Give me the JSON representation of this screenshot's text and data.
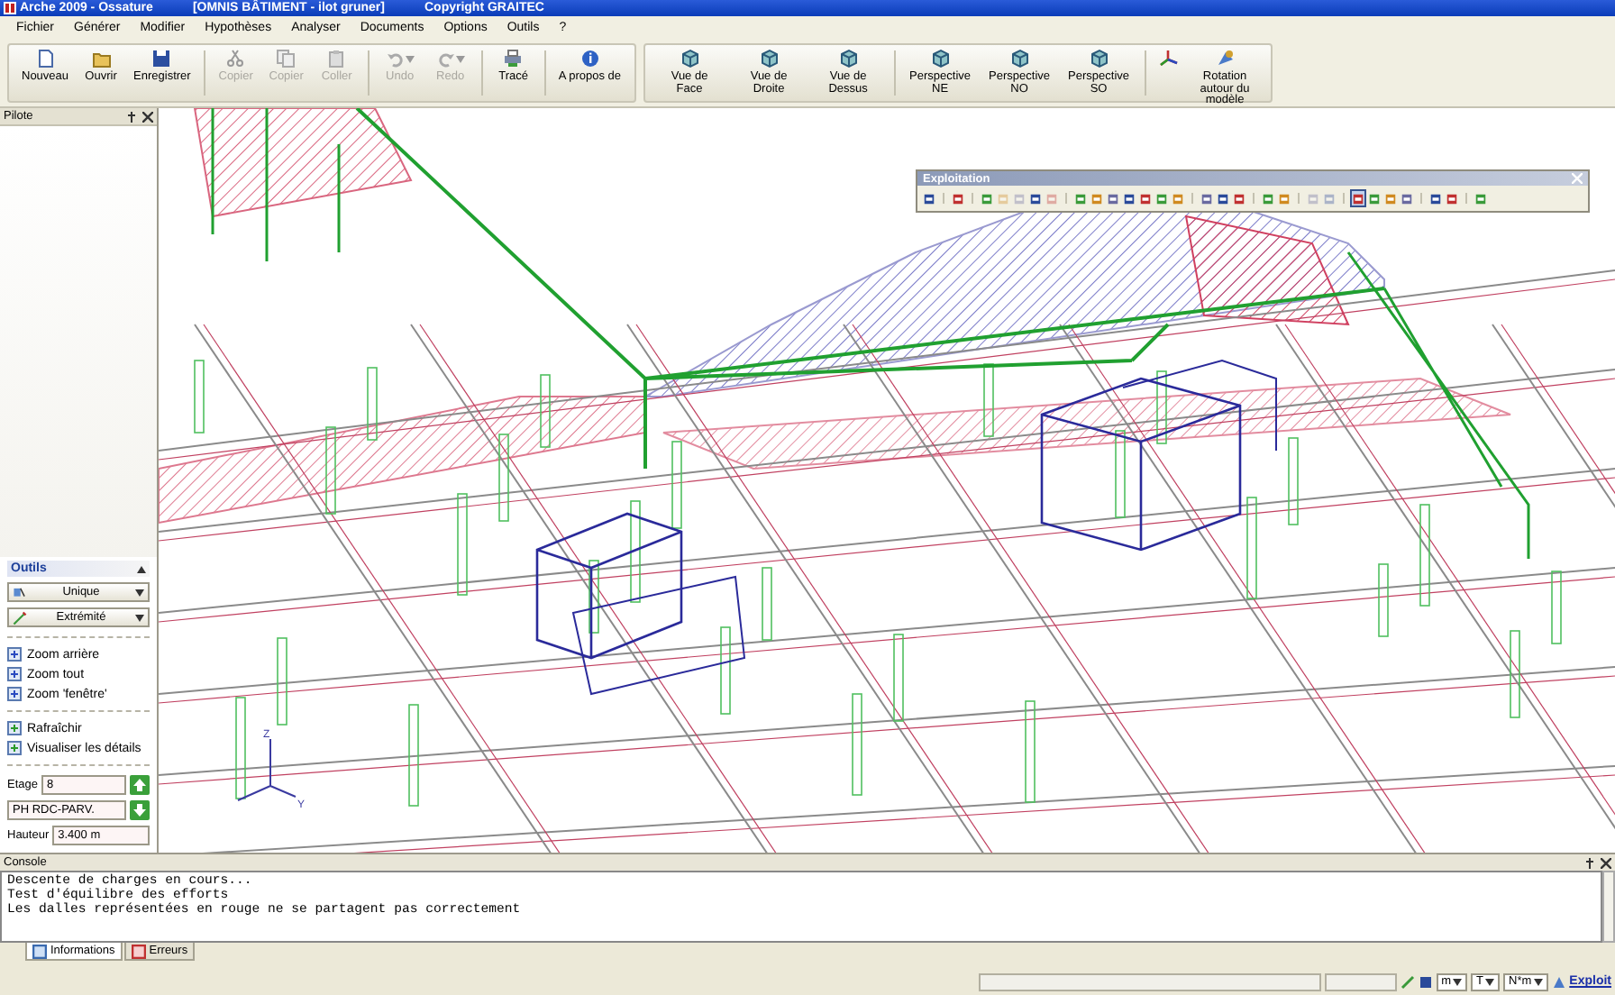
{
  "window": {
    "app": "Arche 2009 - Ossature",
    "document": "[OMNIS BÂTIMENT - ilot gruner]",
    "copyright": "Copyright GRAITEC"
  },
  "menu": [
    "Fichier",
    "Générer",
    "Modifier",
    "Hypothèses",
    "Analyser",
    "Documents",
    "Options",
    "Outils",
    "?"
  ],
  "toolbar": [
    [
      {
        "label": "Nouveau",
        "disabled": false,
        "dropdown": false
      },
      {
        "label": "Ouvrir",
        "disabled": false,
        "dropdown": false
      },
      {
        "label": "Enregistrer",
        "disabled": false,
        "dropdown": false
      }
    ],
    [
      {
        "label": "Copier",
        "disabled": true,
        "dropdown": false
      },
      {
        "label": "Copier",
        "disabled": true,
        "dropdown": false
      },
      {
        "label": "Coller",
        "disabled": true,
        "dropdown": false
      }
    ],
    [
      {
        "label": "Undo",
        "disabled": true,
        "dropdown": true
      },
      {
        "label": "Redo",
        "disabled": true,
        "dropdown": true
      }
    ],
    [
      {
        "label": "Tracé",
        "disabled": false,
        "dropdown": false
      }
    ],
    [
      {
        "label": "A propos de",
        "disabled": false,
        "dropdown": false
      }
    ]
  ],
  "view_toolbar": [
    [
      {
        "kind": "labeled",
        "label": "Vue de Face"
      },
      {
        "kind": "labeled",
        "label": "Vue de Droite"
      },
      {
        "kind": "labeled",
        "label": "Vue de Dessus"
      }
    ],
    [
      {
        "kind": "labeled",
        "label": "Perspective NE"
      },
      {
        "kind": "labeled",
        "label": "Perspective NO"
      },
      {
        "kind": "labeled",
        "label": "Perspective SO"
      }
    ],
    [
      {
        "kind": "icon"
      },
      {
        "kind": "labeled",
        "label": "Rotation autour du modèle"
      }
    ]
  ],
  "pilot_panel": {
    "title": "Pilote"
  },
  "tools_panel": {
    "title": "Outils",
    "dropdowns": [
      "Unique",
      "Extrémité"
    ],
    "action_groups": [
      [
        "Zoom arrière",
        "Zoom tout",
        "Zoom 'fenêtre'"
      ],
      [
        "Rafraîchir",
        "Visualiser les détails"
      ]
    ],
    "storey": {
      "label": "Etage",
      "value": "8",
      "name": "PH RDC-PARV."
    },
    "height": {
      "label": "Hauteur",
      "value": "3.400 m"
    }
  },
  "viewport": {
    "axes": [
      "Z",
      "Y"
    ]
  },
  "exploitation_toolbar": {
    "title": "Exploitation",
    "groups": [
      [
        {
          "disabled": false,
          "selected": false
        }
      ],
      [
        {
          "disabled": false,
          "selected": false
        }
      ],
      [
        {
          "disabled": false,
          "selected": false
        },
        {
          "disabled": true,
          "selected": false
        },
        {
          "disabled": true,
          "selected": false
        },
        {
          "disabled": false,
          "selected": false
        },
        {
          "disabled": true,
          "selected": false
        }
      ],
      [
        {
          "disabled": false,
          "selected": false
        },
        {
          "disabled": false,
          "selected": false
        },
        {
          "disabled": false,
          "selected": false
        },
        {
          "disabled": false,
          "selected": false
        },
        {
          "disabled": false,
          "selected": false
        },
        {
          "disabled": false,
          "selected": false
        },
        {
          "disabled": false,
          "selected": false
        }
      ],
      [
        {
          "disabled": false,
          "selected": false
        },
        {
          "disabled": false,
          "selected": false
        },
        {
          "disabled": false,
          "selected": false
        }
      ],
      [
        {
          "disabled": false,
          "selected": false
        },
        {
          "disabled": false,
          "selected": false
        }
      ],
      [
        {
          "disabled": true,
          "selected": false
        },
        {
          "disabled": true,
          "selected": false
        }
      ],
      [
        {
          "disabled": false,
          "selected": true
        },
        {
          "disabled": false,
          "selected": false
        },
        {
          "disabled": false,
          "selected": false
        },
        {
          "disabled": false,
          "selected": false
        }
      ],
      [
        {
          "disabled": false,
          "selected": false
        },
        {
          "disabled": false,
          "selected": false
        }
      ],
      [
        {
          "disabled": false,
          "selected": false
        }
      ]
    ]
  },
  "console": {
    "title": "Console",
    "lines": [
      "Descente de charges en cours...",
      "Test d'équilibre des efforts",
      "Les dalles représentées en rouge ne se partagent pas correctement"
    ],
    "tabs": [
      {
        "label": "Informations",
        "selected": true
      },
      {
        "label": "Erreurs",
        "selected": false
      }
    ]
  },
  "status_bar": {
    "units": [
      "m",
      "T",
      "N*m"
    ],
    "link": "Exploit"
  }
}
